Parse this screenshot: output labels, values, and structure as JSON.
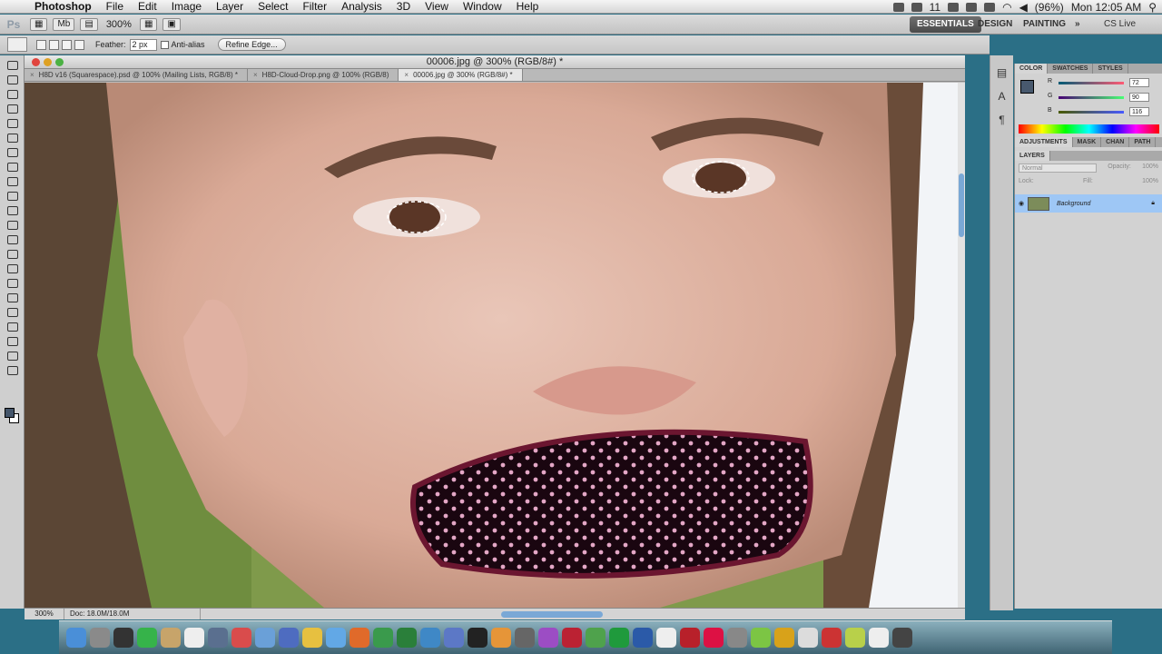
{
  "menubar": {
    "apple": "",
    "app_name": "Photoshop",
    "items": [
      "File",
      "Edit",
      "Image",
      "Layer",
      "Select",
      "Filter",
      "Analysis",
      "3D",
      "View",
      "Window",
      "Help"
    ],
    "status_icon_number": "11",
    "battery": "(96%)",
    "clock": "Mon 12:05 AM"
  },
  "appbar": {
    "logo": "Ps",
    "zoom": "300%",
    "workspaces": [
      "ESSENTIALS",
      "DESIGN",
      "PAINTING"
    ],
    "more": "»",
    "cs_live": "CS Live"
  },
  "options": {
    "feather_label": "Feather:",
    "feather_value": "2 px",
    "antialias_label": "Anti-alias",
    "refine_edge_label": "Refine Edge..."
  },
  "document": {
    "window_title": "00006.jpg @ 300% (RGB/8#) *",
    "tabs": [
      {
        "label": "H8D v16 (Squarespace).psd @ 100% (Mailing Lists, RGB/8) *"
      },
      {
        "label": "H8D-Cloud-Drop.png @ 100% (RGB/8)"
      },
      {
        "label": "00006.jpg @ 300% (RGB/8#) *"
      }
    ],
    "status_zoom": "300%",
    "status_doc": "Doc: 18.0M/18.0M"
  },
  "color_panel": {
    "tabs": [
      "COLOR",
      "SWATCHES",
      "STYLES"
    ],
    "rows": [
      {
        "label": "R",
        "value": "72",
        "grad": "linear-gradient(90deg,#005a74,#ff5a74)"
      },
      {
        "label": "G",
        "value": "90",
        "grad": "linear-gradient(90deg,#480074,#48ff74)"
      },
      {
        "label": "B",
        "value": "116",
        "grad": "linear-gradient(90deg,#485a00,#485aff)"
      }
    ],
    "foreground_color": "#48596e",
    "background_color": "#ffffff"
  },
  "adjust_tabs": [
    "ADJUSTMENTS",
    "MASK",
    "CHAN",
    "PATH"
  ],
  "layers_panel": {
    "title": "LAYERS",
    "blend_mode": "Normal",
    "opacity_label": "Opacity:",
    "opacity_value": "100%",
    "lock_label": "Lock:",
    "fill_label": "Fill:",
    "fill_value": "100%",
    "layers": [
      {
        "name": "Background",
        "visible": true,
        "locked": true
      }
    ]
  }
}
